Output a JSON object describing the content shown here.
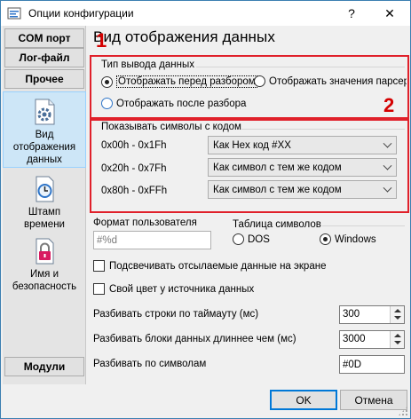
{
  "window": {
    "title": "Опции конфигурации",
    "help_glyph": "?",
    "close_glyph": "✕"
  },
  "sidebar": {
    "top_buttons": [
      {
        "label": "COM порт"
      },
      {
        "label": "Лог-файл"
      },
      {
        "label": "Прочее"
      }
    ],
    "items": [
      {
        "label_line1": "Вид",
        "label_line2": "отображения",
        "label_line3": "данных",
        "icon": "gear-page-icon",
        "selected": true
      },
      {
        "label_line1": "Штамп",
        "label_line2": "времени",
        "icon": "clock-page-icon",
        "selected": false
      },
      {
        "label_line1": "Имя и",
        "label_line2": "безопасность",
        "icon": "lock-page-icon",
        "selected": false
      }
    ],
    "bottom_button": {
      "label": "Модули"
    }
  },
  "main": {
    "title": "Вид отображения данных",
    "annotations": {
      "marker_1": "1",
      "marker_2": "2"
    },
    "output_type": {
      "legend": "Тип вывода данных",
      "options": [
        {
          "label": "Отображать перед разбором",
          "checked": true
        },
        {
          "label": "Отображать значения парсера",
          "checked": false
        },
        {
          "label": "Отображать после разбора",
          "checked": false
        }
      ]
    },
    "symbols": {
      "legend": "Показывать символы с кодом",
      "rows": [
        {
          "range": "0x00h - 0x1Fh",
          "value": "Как Hex код #XX"
        },
        {
          "range": "0x20h - 0x7Fh",
          "value": "Как символ с тем же кодом"
        },
        {
          "range": "0x80h - 0xFFh",
          "value": "Как символ с тем же кодом"
        }
      ]
    },
    "user_format": {
      "label": "Формат пользователя",
      "placeholder": "#%d"
    },
    "charset": {
      "legend": "Таблица символов",
      "options": [
        {
          "label": "DOS",
          "checked": false
        },
        {
          "label": "Windows",
          "checked": true
        }
      ]
    },
    "checkboxes": [
      {
        "label": "Подсвечивать отсылаемые данные на экране",
        "checked": false
      },
      {
        "label": "Свой цвет у источника данных",
        "checked": false
      }
    ],
    "fields": [
      {
        "label": "Разбивать строки по таймауту (мс)",
        "value": "300"
      },
      {
        "label": "Разбивать блоки данных длиннее чем (мс)",
        "value": "3000"
      },
      {
        "label": "Разбивать по символам",
        "value": "#0D"
      }
    ]
  },
  "footer": {
    "ok_label": "OK",
    "cancel_label": "Отмена"
  },
  "colors": {
    "accent": "#0078d7",
    "highlight_box": "#e0202a",
    "selected_item": "#cde6f7"
  }
}
